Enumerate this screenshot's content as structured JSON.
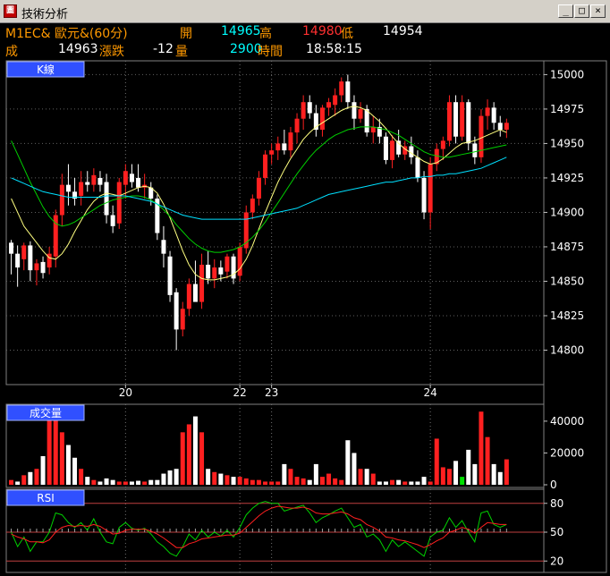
{
  "window": {
    "app_icon": "chart-app-icon",
    "title": "技術分析",
    "buttons": [
      "_",
      "□",
      "×"
    ]
  },
  "info": {
    "row1": {
      "symbol": "M1EC& 歐元&(60分)",
      "open_label": "開",
      "open_value": "14965",
      "high_label": "高",
      "high_value": "14980",
      "low_label": "低",
      "low_value": "14954"
    },
    "row2": {
      "close_label": "成",
      "close_value": "14963",
      "change_label": "漲跌",
      "change_value": "-12",
      "volume_label": "量",
      "volume_value": "2900",
      "time_label": "時間",
      "time_value": "18:58:15"
    }
  },
  "colors": {
    "up": "#ff2020",
    "down": "#ffffff",
    "ma_short": "#ffff80",
    "ma_mid": "#00d000",
    "ma_long": "#00e0ff",
    "panel_label_bg": "#3050ff",
    "label_orange": "#ff9900",
    "value_cyan": "#00ffff",
    "value_red": "#ff3030",
    "axis_text": "#ffffff"
  },
  "chart_data": [
    {
      "type": "candlestick",
      "panel_label": "K線",
      "ylim": [
        14775,
        15010
      ],
      "y_ticks": [
        14800,
        14825,
        14850,
        14875,
        14900,
        14925,
        14950,
        14975,
        15000
      ],
      "x_ticks": [
        {
          "label": "20",
          "bar": 18
        },
        {
          "label": "22",
          "bar": 36
        },
        {
          "label": "23",
          "bar": 41
        },
        {
          "label": "24",
          "bar": 66
        }
      ],
      "grid": true,
      "bars": [
        [
          14878,
          14880,
          14855,
          14870
        ],
        [
          14870,
          14876,
          14846,
          14860
        ],
        [
          14866,
          14878,
          14858,
          14876
        ],
        [
          14876,
          14879,
          14850,
          14858
        ],
        [
          14858,
          14866,
          14847,
          14863
        ],
        [
          14864,
          14868,
          14852,
          14856
        ],
        [
          14860,
          14875,
          14855,
          14870
        ],
        [
          14868,
          14902,
          14860,
          14898
        ],
        [
          14898,
          14928,
          14890,
          14920
        ],
        [
          14920,
          14935,
          14905,
          14915
        ],
        [
          14915,
          14925,
          14905,
          14910
        ],
        [
          14912,
          14930,
          14905,
          14922
        ],
        [
          14922,
          14930,
          14915,
          14920
        ],
        [
          14920,
          14932,
          14915,
          14927
        ],
        [
          14925,
          14930,
          14915,
          14920
        ],
        [
          14922,
          14928,
          14892,
          14898
        ],
        [
          14898,
          14905,
          14885,
          14890
        ],
        [
          14892,
          14925,
          14888,
          14922
        ],
        [
          14920,
          14935,
          14910,
          14930
        ],
        [
          14928,
          14935,
          14918,
          14922
        ],
        [
          14925,
          14935,
          14915,
          14918
        ],
        [
          14918,
          14928,
          14910,
          14920
        ],
        [
          14918,
          14922,
          14905,
          14910
        ],
        [
          14910,
          14913,
          14880,
          14885
        ],
        [
          14880,
          14890,
          14860,
          14870
        ],
        [
          14868,
          14872,
          14835,
          14840
        ],
        [
          14842,
          14845,
          14800,
          14815
        ],
        [
          14815,
          14835,
          14810,
          14830
        ],
        [
          14830,
          14852,
          14825,
          14848
        ],
        [
          14848,
          14865,
          14840,
          14835
        ],
        [
          14835,
          14870,
          14830,
          14862
        ],
        [
          14862,
          14872,
          14848,
          14852
        ],
        [
          14852,
          14866,
          14845,
          14860
        ],
        [
          14860,
          14865,
          14850,
          14855
        ],
        [
          14857,
          14870,
          14852,
          14868
        ],
        [
          14868,
          14870,
          14848,
          14852
        ],
        [
          14854,
          14878,
          14850,
          14875
        ],
        [
          14874,
          14905,
          14870,
          14900
        ],
        [
          14900,
          14913,
          14895,
          14910
        ],
        [
          14910,
          14930,
          14905,
          14925
        ],
        [
          14925,
          14945,
          14920,
          14942
        ],
        [
          14942,
          14950,
          14935,
          14945
        ],
        [
          14945,
          14955,
          14938,
          14950
        ],
        [
          14950,
          14960,
          14942,
          14945
        ],
        [
          14945,
          14962,
          14940,
          14958
        ],
        [
          14958,
          14972,
          14950,
          14968
        ],
        [
          14968,
          14985,
          14960,
          14980
        ],
        [
          14980,
          14985,
          14968,
          14972
        ],
        [
          14972,
          14978,
          14955,
          14960
        ],
        [
          14960,
          14978,
          14955,
          14976
        ],
        [
          14976,
          14983,
          14970,
          14980
        ],
        [
          14978,
          14990,
          14970,
          14985
        ],
        [
          14985,
          14998,
          14980,
          14995
        ],
        [
          14995,
          15000,
          14975,
          14980
        ],
        [
          14980,
          14985,
          14960,
          14968
        ],
        [
          14968,
          14980,
          14965,
          14975
        ],
        [
          14975,
          14978,
          14955,
          14958
        ],
        [
          14958,
          14970,
          14950,
          14962
        ],
        [
          14962,
          14968,
          14950,
          14955
        ],
        [
          14955,
          14958,
          14935,
          14938
        ],
        [
          14938,
          14956,
          14932,
          14952
        ],
        [
          14952,
          14960,
          14940,
          14942
        ],
        [
          14942,
          14952,
          14938,
          14948
        ],
        [
          14948,
          14955,
          14935,
          14940
        ],
        [
          14940,
          14945,
          14922,
          14925
        ],
        [
          14925,
          14930,
          14895,
          14900
        ],
        [
          14900,
          14940,
          14888,
          14935
        ],
        [
          14935,
          14950,
          14930,
          14946
        ],
        [
          14946,
          14955,
          14938,
          14952
        ],
        [
          14952,
          14985,
          14948,
          14980
        ],
        [
          14980,
          14985,
          14950,
          14955
        ],
        [
          14955,
          14985,
          14952,
          14980
        ],
        [
          14980,
          14982,
          14945,
          14950
        ],
        [
          14950,
          14955,
          14935,
          14940
        ],
        [
          14940,
          14975,
          14936,
          14970
        ],
        [
          14970,
          14982,
          14960,
          14976
        ],
        [
          14976,
          14980,
          14960,
          14965
        ],
        [
          14965,
          14970,
          14955,
          14960
        ],
        [
          14960,
          14968,
          14954,
          14965
        ]
      ],
      "moving_averages": [
        {
          "name": "short",
          "color_key": "ma_short",
          "values": [
            14910,
            14900,
            14890,
            14884,
            14878,
            14872,
            14867,
            14866,
            14870,
            14877,
            14886,
            14894,
            14902,
            14908,
            14912,
            14914,
            14913,
            14912,
            14914,
            14916,
            14918,
            14919,
            14918,
            14914,
            14906,
            14896,
            14884,
            14872,
            14862,
            14855,
            14852,
            14851,
            14851,
            14852,
            14853,
            14855,
            14859,
            14866,
            14876,
            14888,
            14900,
            14911,
            14922,
            14931,
            14939,
            14946,
            14953,
            14958,
            14962,
            14965,
            14968,
            14971,
            14974,
            14976,
            14977,
            14976,
            14974,
            14970,
            14966,
            14961,
            14955,
            14950,
            14946,
            14943,
            14940,
            14937,
            14935,
            14936,
            14939,
            14943,
            14947,
            14950,
            14951,
            14952,
            14954,
            14956,
            14958,
            14960,
            14958
          ]
        },
        {
          "name": "mid",
          "color_key": "ma_mid",
          "values": [
            14952,
            14942,
            14932,
            14922,
            14913,
            14904,
            14897,
            14892,
            14890,
            14891,
            14893,
            14896,
            14899,
            14902,
            14905,
            14907,
            14909,
            14910,
            14911,
            14912,
            14912,
            14911,
            14909,
            14906,
            14902,
            14897,
            14891,
            14886,
            14881,
            14877,
            14874,
            14872,
            14871,
            14871,
            14872,
            14873,
            14875,
            14878,
            14882,
            14887,
            14893,
            14900,
            14907,
            14914,
            14921,
            14928,
            14934,
            14940,
            14945,
            14949,
            14953,
            14956,
            14958,
            14960,
            14961,
            14962,
            14962,
            14962,
            14961,
            14960,
            14958,
            14956,
            14953,
            14950,
            14947,
            14944,
            14942,
            14941,
            14940,
            14940,
            14941,
            14942,
            14943,
            14944,
            14945,
            14946,
            14947,
            14948,
            14949
          ]
        },
        {
          "name": "long",
          "color_key": "ma_long",
          "values": [
            14925,
            14923,
            14921,
            14919,
            14917,
            14915,
            14914,
            14913,
            14912,
            14911,
            14911,
            14911,
            14911,
            14911,
            14911,
            14912,
            14912,
            14912,
            14912,
            14911,
            14910,
            14909,
            14908,
            14906,
            14904,
            14902,
            14900,
            14898,
            14897,
            14896,
            14895,
            14895,
            14895,
            14895,
            14895,
            14895,
            14895,
            14895,
            14896,
            14897,
            14898,
            14899,
            14900,
            14901,
            14902,
            14903,
            14905,
            14907,
            14909,
            14911,
            14913,
            14914,
            14915,
            14916,
            14917,
            14918,
            14919,
            14920,
            14921,
            14922,
            14922,
            14923,
            14924,
            14925,
            14925,
            14926,
            14926,
            14927,
            14927,
            14928,
            14928,
            14929,
            14930,
            14931,
            14932,
            14934,
            14936,
            14938,
            14940
          ]
        }
      ]
    },
    {
      "type": "bar",
      "panel_label": "成交量",
      "ylim": [
        0,
        45000
      ],
      "y_ticks": [
        0,
        20000,
        40000
      ],
      "values": [
        3000,
        2000,
        6000,
        8000,
        10000,
        18000,
        46000,
        46000,
        33000,
        25000,
        17000,
        10000,
        5000,
        3000,
        2000,
        4000,
        3000,
        2000,
        2000,
        2000,
        2500,
        2000,
        3000,
        3000,
        7000,
        9000,
        10000,
        33000,
        38000,
        43000,
        33000,
        10000,
        8000,
        7000,
        6000,
        5000,
        5000,
        4000,
        3000,
        3000,
        2000,
        2000,
        2000,
        13000,
        10000,
        5000,
        4000,
        3000,
        13000,
        5000,
        7000,
        4000,
        3000,
        28000,
        20000,
        10000,
        10000,
        7000,
        2000,
        2000,
        3000,
        3000,
        2000,
        2000,
        2000,
        5000,
        2000,
        29000,
        11000,
        10000,
        15000,
        5000,
        22000,
        13000,
        46000,
        30000,
        13000,
        8000,
        16000
      ],
      "up_flags": [
        1,
        0,
        1,
        0,
        1,
        0,
        1,
        1,
        1,
        0,
        0,
        1,
        0,
        1,
        0,
        0,
        0,
        1,
        1,
        0,
        0,
        1,
        0,
        0,
        0,
        0,
        0,
        1,
        1,
        0,
        1,
        0,
        1,
        0,
        1,
        0,
        1,
        1,
        1,
        1,
        1,
        1,
        1,
        0,
        1,
        1,
        1,
        0,
        0,
        1,
        1,
        1,
        1,
        0,
        0,
        1,
        0,
        1,
        0,
        0,
        1,
        0,
        1,
        0,
        0,
        0,
        1,
        1,
        1,
        1,
        0,
        1,
        0,
        0,
        1,
        1,
        0,
        0,
        1
      ],
      "green_bar_index": 71
    },
    {
      "type": "line",
      "panel_label": "RSI",
      "ylim": [
        10,
        90
      ],
      "y_ticks": [
        20,
        50,
        80
      ],
      "reference_lines": [
        20,
        50,
        80
      ],
      "series": [
        {
          "color_key": "ma_mid",
          "values": [
            50,
            35,
            45,
            30,
            40,
            40,
            50,
            70,
            68,
            60,
            55,
            60,
            52,
            64,
            50,
            40,
            38,
            55,
            60,
            54,
            52,
            54,
            48,
            40,
            35,
            28,
            25,
            35,
            48,
            42,
            52,
            45,
            50,
            46,
            52,
            45,
            55,
            68,
            75,
            80,
            82,
            80,
            80,
            72,
            74,
            76,
            78,
            70,
            60,
            65,
            68,
            72,
            75,
            65,
            55,
            58,
            45,
            48,
            42,
            30,
            42,
            35,
            40,
            35,
            30,
            25,
            45,
            50,
            52,
            65,
            55,
            62,
            50,
            40,
            70,
            72,
            58,
            55,
            58
          ]
        },
        {
          "color_key": "up",
          "values": [
            48,
            45,
            43,
            40,
            40,
            39,
            42,
            50,
            55,
            57,
            56,
            57,
            56,
            58,
            56,
            52,
            48,
            49,
            52,
            53,
            53,
            53,
            51,
            48,
            44,
            39,
            34,
            34,
            38,
            40,
            43,
            44,
            45,
            46,
            47,
            47,
            49,
            55,
            61,
            67,
            72,
            75,
            77,
            76,
            75,
            75,
            76,
            74,
            70,
            69,
            69,
            70,
            71,
            69,
            65,
            63,
            58,
            55,
            51,
            45,
            44,
            42,
            41,
            39,
            37,
            34,
            37,
            41,
            44,
            50,
            52,
            55,
            53,
            49,
            55,
            60,
            59,
            58,
            58
          ]
        }
      ]
    }
  ]
}
